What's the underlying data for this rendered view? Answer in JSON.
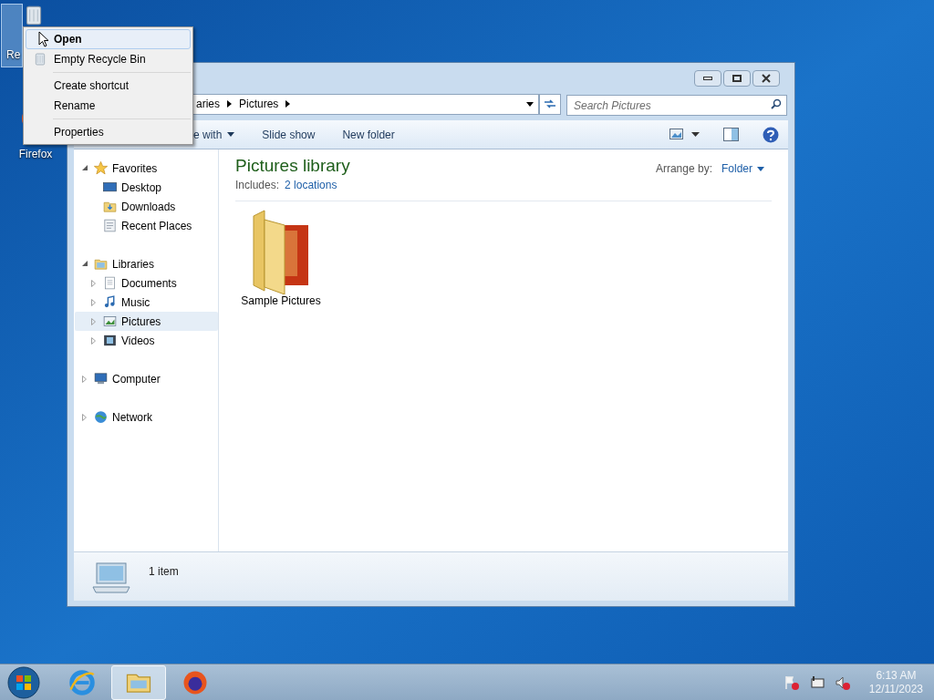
{
  "desktop_icons": [
    {
      "kind": "bin",
      "label": "Re",
      "selected": true
    },
    {
      "kind": "firefox",
      "label": "Firefox",
      "selected": false
    }
  ],
  "context_menu": [
    [
      {
        "kind": "bold",
        "label": "Open",
        "selected": true
      },
      {
        "kind": "bin",
        "label": "Empty Recycle Bin",
        "selected": false
      }
    ],
    [
      {
        "kind": "plain",
        "label": "Create shortcut",
        "selected": false
      },
      {
        "kind": "plain",
        "label": "Rename",
        "selected": false
      }
    ],
    [
      {
        "kind": "plain",
        "label": "Properties",
        "selected": false
      }
    ]
  ],
  "window": {
    "breadcrumb": [
      "aries",
      "Pictures"
    ],
    "search": {
      "placeholder": "Search Pictures"
    },
    "toolbar": [
      {
        "label": "e with",
        "dropdown": true
      },
      {
        "label": "Slide show",
        "dropdown": false
      },
      {
        "label": "New folder",
        "dropdown": false
      }
    ],
    "nav": [
      {
        "label": "Favorites",
        "kind": "star",
        "expanded": true,
        "selected": false,
        "children": [
          {
            "label": "Desktop",
            "kind": "desktop",
            "selected": false
          },
          {
            "label": "Downloads",
            "kind": "downloads",
            "selected": false
          },
          {
            "label": "Recent Places",
            "kind": "places",
            "selected": false
          }
        ]
      },
      {
        "label": "Libraries",
        "kind": "library",
        "expanded": true,
        "selected": false,
        "children": [
          {
            "label": "Documents",
            "kind": "documents",
            "selected": false
          },
          {
            "label": "Music",
            "kind": "music",
            "selected": false
          },
          {
            "label": "Pictures",
            "kind": "pictures",
            "selected": true
          },
          {
            "label": "Videos",
            "kind": "videos",
            "selected": false
          }
        ]
      },
      {
        "label": "Computer",
        "kind": "computer",
        "expanded": false,
        "selected": false
      },
      {
        "label": "Network",
        "kind": "network",
        "expanded": false,
        "selected": false
      }
    ],
    "header": {
      "title": "Pictures library",
      "includes_label": "Includes:",
      "includes_link": "2 locations",
      "arrange_label": "Arrange by:",
      "arrange_value": "Folder"
    },
    "items": [
      {
        "label": "Sample Pictures"
      }
    ],
    "status": "1 item"
  },
  "taskbar": {
    "apps": [
      {
        "kind": "ie",
        "active": false
      },
      {
        "kind": "explorer",
        "active": true
      },
      {
        "kind": "firefox",
        "active": false
      }
    ],
    "time": "6:13 AM",
    "date": "12/11/2023"
  }
}
